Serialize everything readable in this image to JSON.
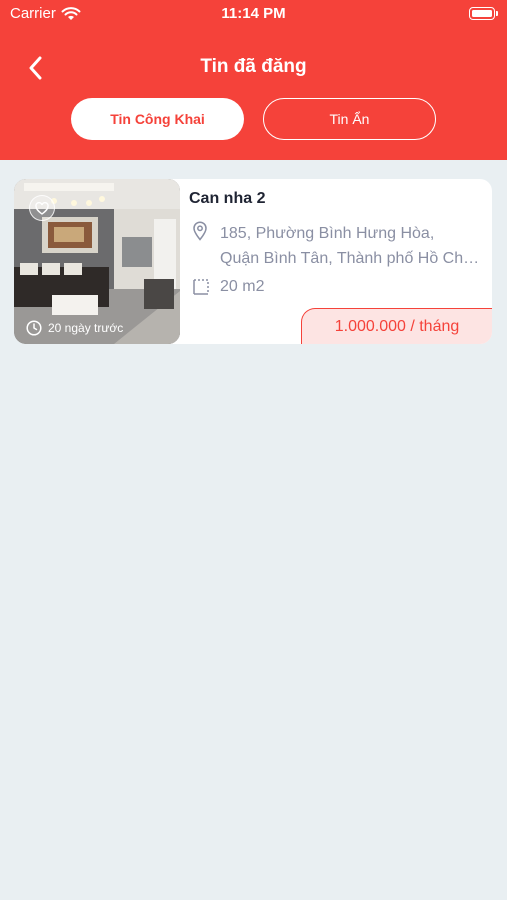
{
  "status_bar": {
    "carrier": "Carrier",
    "time": "11:14 PM"
  },
  "header": {
    "title": "Tin đã đăng"
  },
  "tabs": [
    {
      "label": "Tin Công Khai",
      "active": true
    },
    {
      "label": "Tin Ẩn",
      "active": false
    }
  ],
  "listings": [
    {
      "title": "Can nha 2",
      "address_line1": "185, Phường Bình Hưng Hòa,",
      "address_line2": "Quận Bình Tân, Thành phố Hồ Chí Minh",
      "area": "20 m2",
      "price": "1.000.000 / tháng",
      "posted": "20 ngày trước"
    }
  ],
  "colors": {
    "brand": "#f5423a",
    "background": "#e9eff2",
    "price_bg": "#fde4e3"
  },
  "icons": [
    "wifi-icon",
    "battery-icon",
    "back-chevron-icon",
    "heart-icon",
    "clock-icon",
    "location-pin-icon",
    "area-icon"
  ]
}
